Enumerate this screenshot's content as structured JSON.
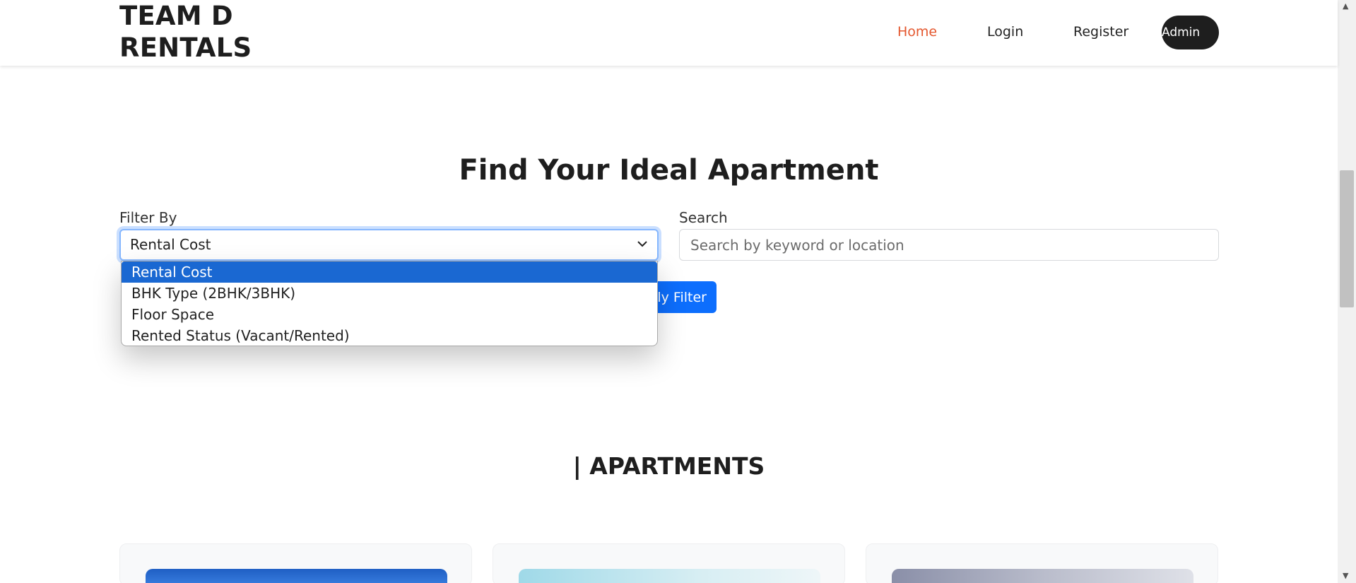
{
  "brand": {
    "line1": "TEAM D",
    "line2": "RENTALS"
  },
  "nav": {
    "home": "Home",
    "login": "Login",
    "register": "Register",
    "admin": "Admin"
  },
  "main": {
    "heading": "Find Your Ideal Apartment",
    "filter_label": "Filter By",
    "filter_selected": "Rental Cost",
    "filter_options": [
      "Rental Cost",
      "BHK Type (2BHK/3BHK)",
      "Floor Space",
      "Rented Status (Vacant/Rented)"
    ],
    "search_label": "Search",
    "search_placeholder": "Search by keyword or location",
    "apply_button": "Apply Filter"
  },
  "apartments": {
    "title": "| APARTMENTS"
  },
  "colors": {
    "accent": "#e4572e",
    "primary": "#0d6efd",
    "dark": "#1e1e1e"
  }
}
